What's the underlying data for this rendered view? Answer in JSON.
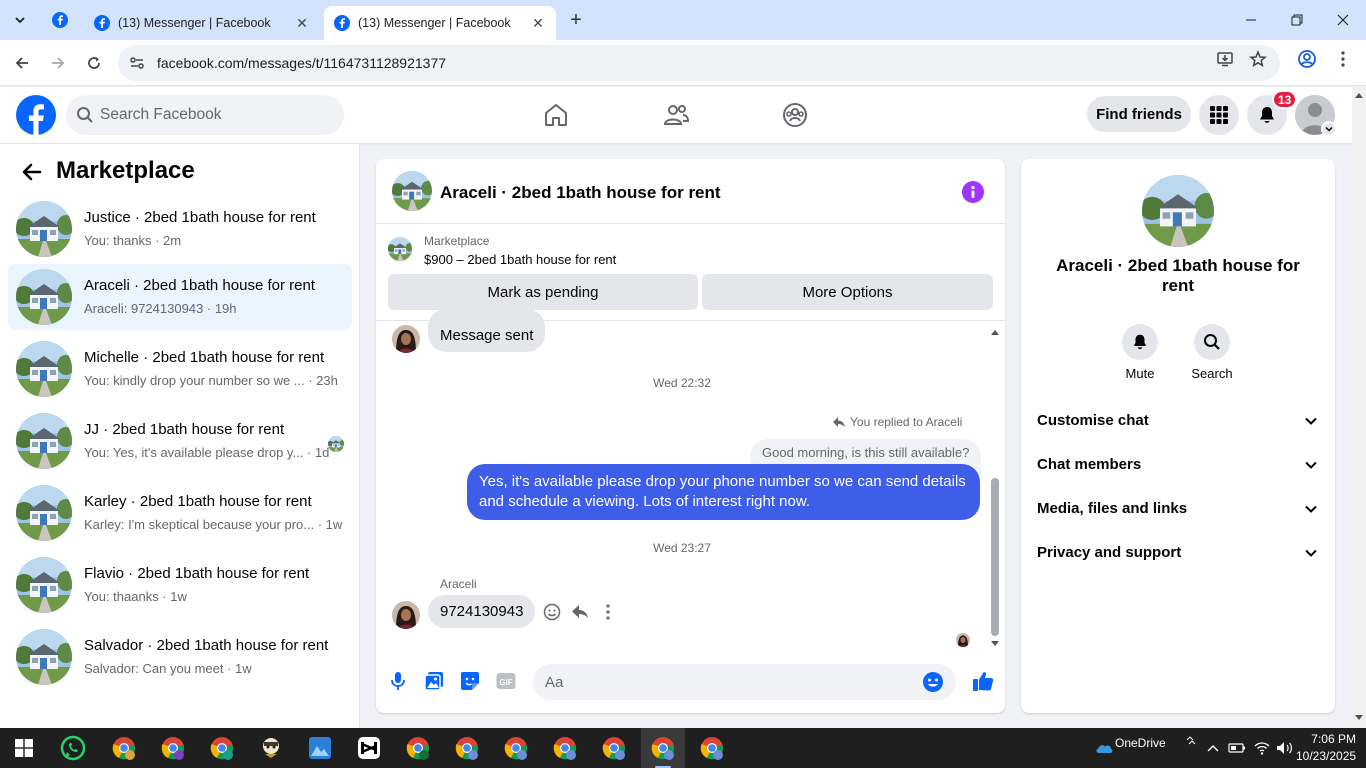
{
  "browser": {
    "tabs": [
      {
        "title": "(13) Messenger | Facebook",
        "active": false
      },
      {
        "title": "(13) Messenger | Facebook",
        "active": true
      }
    ],
    "url": "facebook.com/messages/t/1164731128921377"
  },
  "fb_header": {
    "search_placeholder": "Search Facebook",
    "find_friends_label": "Find friends",
    "notifications_count": "13"
  },
  "left_panel": {
    "title": "Marketplace",
    "conversations": [
      {
        "name": "Justice · 2bed 1bath house for rent",
        "snippet": "You: thanks · 2m",
        "selected": false
      },
      {
        "name": "Araceli · 2bed 1bath house for rent",
        "snippet": "Araceli: 9724130943 · 19h",
        "selected": true
      },
      {
        "name": "Michelle · 2bed 1bath house for rent",
        "snippet": "You: kindly drop your number so we ... · 23h",
        "selected": false
      },
      {
        "name": "JJ · 2bed 1bath house for rent",
        "snippet": "You: Yes, it's available please drop y... · 1d",
        "selected": false
      },
      {
        "name": "Karley · 2bed 1bath house for rent",
        "snippet": "Karley: I'm skeptical because your pro... · 1w",
        "selected": false
      },
      {
        "name": "Flavio · 2bed 1bath house for rent",
        "snippet": "You: thaanks · 1w",
        "selected": false
      },
      {
        "name": "Salvador · 2bed 1bath house for rent",
        "snippet": "Salvador: Can you meet · 1w",
        "selected": false
      }
    ]
  },
  "chat": {
    "title": "Araceli · 2bed 1bath house for rent",
    "marketplace_label": "Marketplace",
    "listing": "$900 – 2bed 1bath house for rent",
    "mark_pending_label": "Mark as pending",
    "more_options_label": "More Options",
    "messages": {
      "first_in": "Message sent",
      "time1": "Wed 22:32",
      "replied_label": "You replied to Araceli",
      "quoted": "Good morning, is this still available?",
      "out_text": "Yes, it's available please drop your phone number so we can send details and schedule a viewing. Lots of interest right now.",
      "time2": "Wed 23:27",
      "sender": "Araceli",
      "last_in": "9724130943"
    },
    "composer_placeholder": "Aa"
  },
  "right_panel": {
    "title": "Araceli · 2bed 1bath house for rent",
    "mute_label": "Mute",
    "search_label": "Search",
    "sections": [
      "Customise chat",
      "Chat members",
      "Media, files and links",
      "Privacy and support"
    ]
  },
  "taskbar": {
    "onedrive_label": "OneDrive",
    "time": "7:06 PM",
    "date": "10/23/2025"
  },
  "colors": {
    "fb_blue": "#0866ff",
    "messenger_purple": "#a033ff",
    "outgoing_bubble": "#3e5de8",
    "notif_red": "#e41e3f"
  }
}
